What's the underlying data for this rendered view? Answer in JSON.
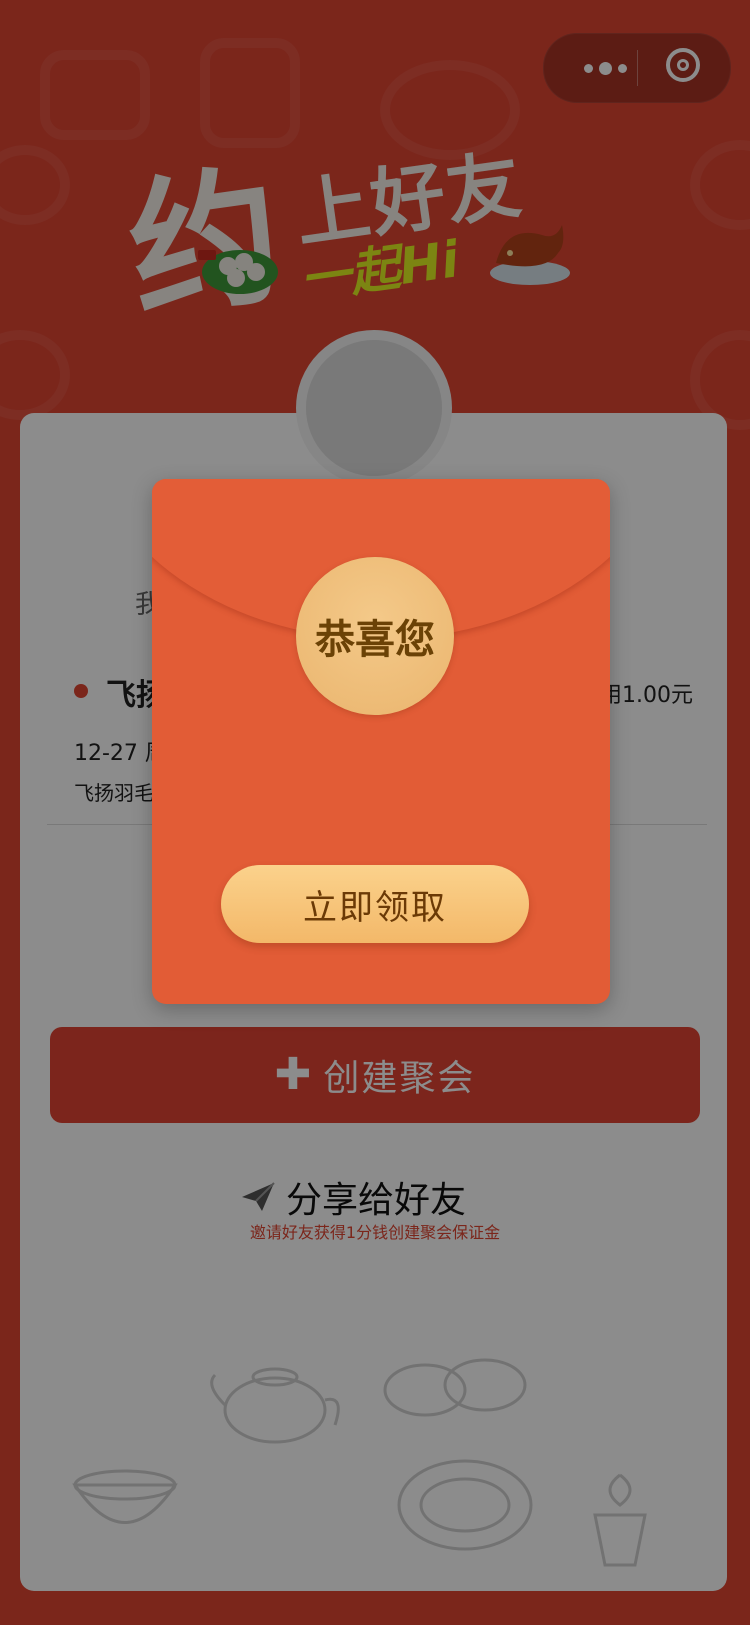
{
  "header": {
    "headline_big": "约",
    "headline_line1": "上好友",
    "headline_line2": "一起Hi"
  },
  "card": {
    "line_partial_1": "我",
    "event_title_partial": "飞扬",
    "event_price_partial": "用1.00元",
    "event_date_partial": "12-27 周",
    "event_location_partial": "飞扬羽毛"
  },
  "create_button": {
    "icon": "plus-icon",
    "label": "创建聚会"
  },
  "share": {
    "icon": "paper-plane-icon",
    "label": "分享给好友",
    "hint": "邀请好友获得1分钱创建聚会保证金"
  },
  "modal": {
    "seal_text": "恭喜您",
    "claim_label": "立即领取"
  },
  "colors": {
    "brand_red": "#e14532",
    "envelope": "#e25c36",
    "gold": "#f3b869"
  }
}
